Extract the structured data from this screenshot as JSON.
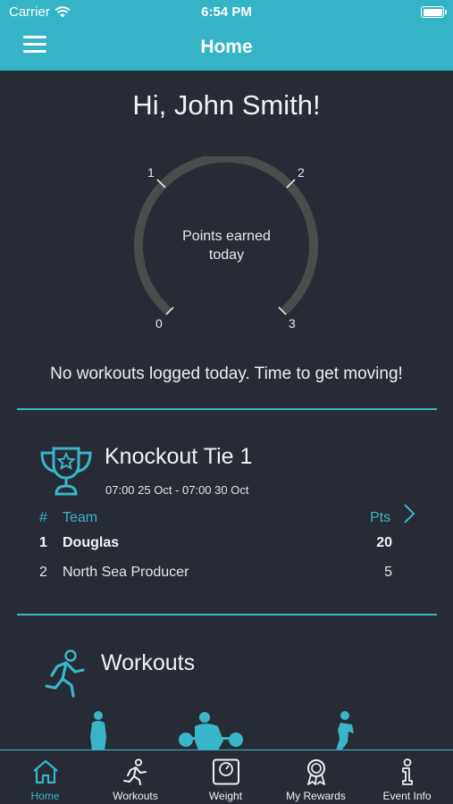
{
  "status_bar": {
    "carrier": "Carrier",
    "time": "6:54 PM"
  },
  "nav": {
    "title": "Home",
    "menu_icon": "hamburger-icon"
  },
  "home": {
    "greeting": "Hi, John Smith!",
    "gauge": {
      "label_line1": "Points earned",
      "label_line2": "today",
      "ticks": [
        "0",
        "1",
        "2",
        "3"
      ],
      "value": 0,
      "max": 3
    },
    "no_workouts_message": "No workouts logged today. Time to get moving!"
  },
  "knockout": {
    "icon": "trophy-icon",
    "title": "Knockout Tie 1",
    "dates": "07:00 25 Oct  -  07:00 30 Oct",
    "headers": {
      "rank": "#",
      "team": "Team",
      "points": "Pts"
    },
    "rows": [
      {
        "rank": "1",
        "team": "Douglas",
        "points": "20"
      },
      {
        "rank": "2",
        "team": "North Sea Producer",
        "points": "5"
      }
    ]
  },
  "workouts": {
    "icon": "runner-icon",
    "title": "Workouts"
  },
  "tabs": [
    {
      "label": "Home",
      "icon": "home-icon",
      "active": true
    },
    {
      "label": "Workouts",
      "icon": "workouts-icon",
      "active": false
    },
    {
      "label": "Weight",
      "icon": "scale-icon",
      "active": false
    },
    {
      "label": "My Rewards",
      "icon": "rewards-icon",
      "active": false
    },
    {
      "label": "Event Info",
      "icon": "info-icon",
      "active": false
    }
  ],
  "colors": {
    "accent": "#35b3c7",
    "background": "#272b35",
    "gauge_track": "#4b4c4c"
  }
}
